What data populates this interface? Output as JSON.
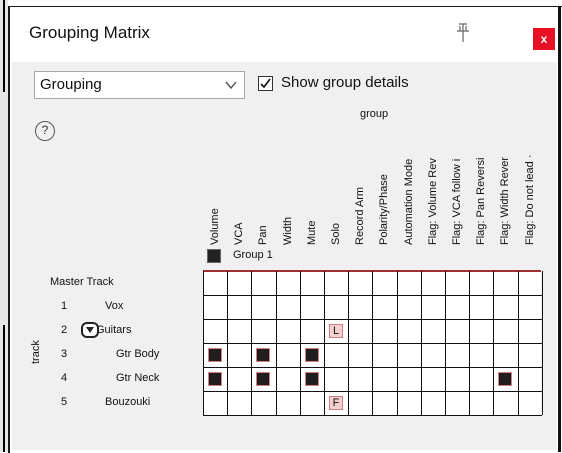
{
  "window": {
    "title": "Grouping Matrix",
    "close_label": "x"
  },
  "toolbar": {
    "mode_select": "Grouping",
    "show_details_label": "Show group details",
    "show_details_checked": true,
    "help_label": "?"
  },
  "matrix": {
    "group_axis_label": "group",
    "track_axis_label": "track",
    "columns": [
      "Volume",
      "VCA",
      "Pan",
      "Width",
      "Mute",
      "Solo",
      "Record Arm",
      "Polarity/Phase",
      "Automation Mode",
      "Flag: Volume Rev",
      "Flag: VCA follow i",
      "Flag: Pan Reversi",
      "Flag: Width Rever",
      "Flag: Do not lead ·"
    ],
    "groups": [
      {
        "name": "Group 1",
        "color": "#222222"
      }
    ],
    "rows": [
      {
        "number": "",
        "name": "Master Track"
      },
      {
        "number": "1",
        "name": "Vox"
      },
      {
        "number": "2",
        "name": "Guitars",
        "folder": true
      },
      {
        "number": "3",
        "name": "Gtr Body"
      },
      {
        "number": "4",
        "name": "Gtr Neck"
      },
      {
        "number": "5",
        "name": "Bouzouki"
      }
    ],
    "cells": [
      {
        "row": 2,
        "col": 5,
        "state": "letter",
        "text": "L"
      },
      {
        "row": 3,
        "col": 0,
        "state": "member"
      },
      {
        "row": 3,
        "col": 2,
        "state": "member"
      },
      {
        "row": 3,
        "col": 4,
        "state": "member"
      },
      {
        "row": 4,
        "col": 0,
        "state": "member"
      },
      {
        "row": 4,
        "col": 2,
        "state": "member"
      },
      {
        "row": 4,
        "col": 4,
        "state": "member"
      },
      {
        "row": 4,
        "col": 12,
        "state": "member"
      },
      {
        "row": 5,
        "col": 5,
        "state": "letter",
        "text": "F"
      }
    ]
  },
  "colors": {
    "member_fill": "#1e1e1e",
    "member_border": "#d28080",
    "letter_fill": "#f4d0d0",
    "close_button": "#e81123"
  }
}
